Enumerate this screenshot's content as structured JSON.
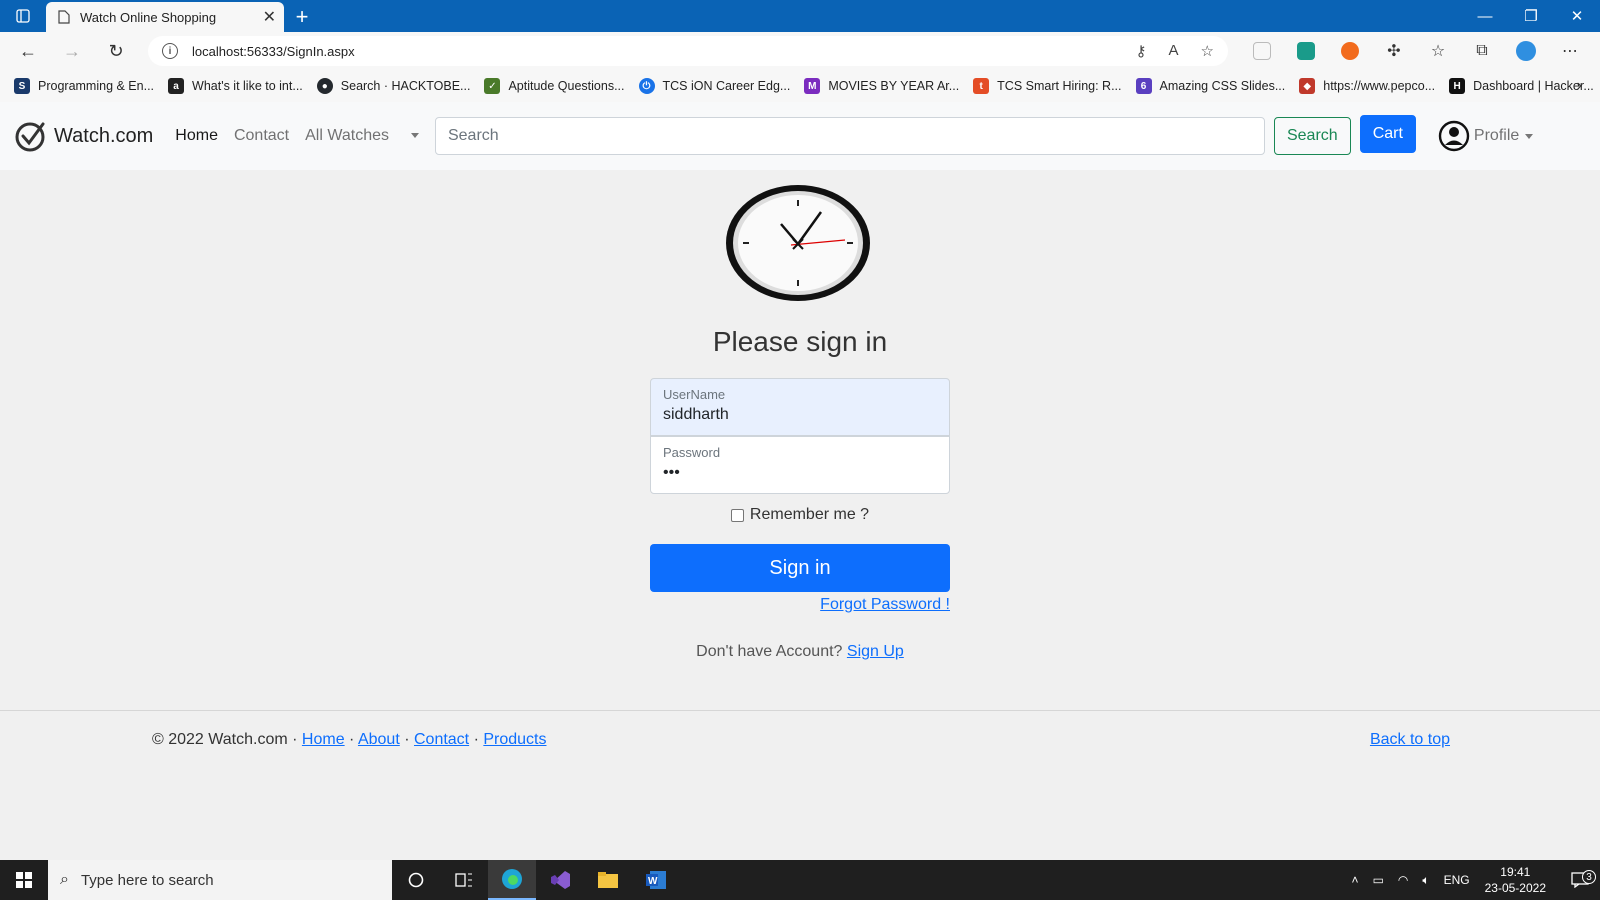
{
  "browser": {
    "tab_title": "Watch Online Shopping",
    "url": "localhost:56333/SignIn.aspx"
  },
  "bookmarks": [
    {
      "label": "Programming & En...",
      "color": "#1a3a6b"
    },
    {
      "label": "What's it like to int...",
      "color": "#222222"
    },
    {
      "label": "Search · HACKTOBE...",
      "color": "#24292e"
    },
    {
      "label": "Aptitude Questions...",
      "color": "#4a7a2a"
    },
    {
      "label": "TCS iON Career Edg...",
      "color": "#1a73e8"
    },
    {
      "label": "MOVIES BY YEAR Ar...",
      "color": "#7b2cbf"
    },
    {
      "label": "TCS Smart Hiring: R...",
      "color": "#e44d26"
    },
    {
      "label": "Amazing CSS Slides...",
      "color": "#5a3fc0"
    },
    {
      "label": "https://www.pepco...",
      "color": "#c0392b"
    },
    {
      "label": "Dashboard | Hacker...",
      "color": "#111111"
    }
  ],
  "navbar": {
    "brand": "Watch.com",
    "home": "Home",
    "contact": "Contact",
    "all_watches": "All Watches",
    "search_placeholder": "Search",
    "search_button": "Search",
    "cart_button": "Cart",
    "profile": "Profile"
  },
  "signin": {
    "heading": "Please sign in",
    "username_label": "UserName",
    "username_value": "siddharth",
    "password_label": "Password",
    "password_value": "•••",
    "remember_label": "Remember me ?",
    "submit": "Sign in",
    "forgot": "Forgot Password !",
    "no_account": "Don't have Account?",
    "signup": "Sign Up"
  },
  "footer": {
    "copyright": "© 2022 Watch.com",
    "links": [
      "Home",
      "About",
      "Contact",
      "Products"
    ],
    "back_to_top": "Back to top"
  },
  "taskbar": {
    "search_placeholder": "Type here to search",
    "lang": "ENG",
    "time": "19:41",
    "date": "23-05-2022",
    "notifications": "3"
  },
  "colors": {
    "primary": "#0d6efd",
    "success": "#198754",
    "titlebar": "#0a63b5"
  }
}
